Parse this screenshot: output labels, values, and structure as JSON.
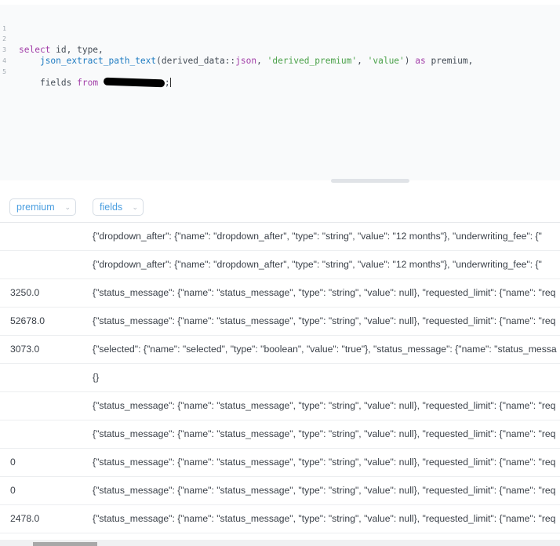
{
  "editor": {
    "lines": [
      {
        "num": "1"
      },
      {
        "num": "2",
        "p1": "select",
        "p2": " id, type,"
      },
      {
        "num": "3",
        "indent": "    ",
        "fn": "json_extract_path_text",
        "p1": "(derived_data::",
        "kw": "json",
        "p2": ", ",
        "s1": "'derived_premium'",
        "p3": ", ",
        "s2": "'value'",
        "p4": ") ",
        "kw2": "as",
        "p5": " premium,"
      },
      {
        "num": "4"
      },
      {
        "num": "5",
        "indent": "    ",
        "p1": "fields ",
        "kw": "from",
        "p2": " ",
        "p3": ";"
      }
    ]
  },
  "results": {
    "columns": [
      {
        "label": "premium"
      },
      {
        "label": "fields"
      }
    ],
    "rows": [
      {
        "premium": "",
        "fields": "{\"dropdown_after\": {\"name\": \"dropdown_after\", \"type\": \"string\", \"value\": \"12 months\"}, \"underwriting_fee\": {\""
      },
      {
        "premium": "",
        "fields": "{\"dropdown_after\": {\"name\": \"dropdown_after\", \"type\": \"string\", \"value\": \"12 months\"}, \"underwriting_fee\": {\""
      },
      {
        "premium": "3250.0",
        "fields": "{\"status_message\": {\"name\": \"status_message\", \"type\": \"string\", \"value\": null}, \"requested_limit\": {\"name\": \"req"
      },
      {
        "premium": "52678.0",
        "fields": "{\"status_message\": {\"name\": \"status_message\", \"type\": \"string\", \"value\": null}, \"requested_limit\": {\"name\": \"req"
      },
      {
        "premium": "3073.0",
        "fields": "{\"selected\": {\"name\": \"selected\", \"type\": \"boolean\", \"value\": \"true\"}, \"status_message\": {\"name\": \"status_messa"
      },
      {
        "premium": "",
        "fields": "{}"
      },
      {
        "premium": "",
        "fields": "{\"status_message\": {\"name\": \"status_message\", \"type\": \"string\", \"value\": null}, \"requested_limit\": {\"name\": \"req"
      },
      {
        "premium": "",
        "fields": "{\"status_message\": {\"name\": \"status_message\", \"type\": \"string\", \"value\": null}, \"requested_limit\": {\"name\": \"req"
      },
      {
        "premium": "0",
        "fields": "{\"status_message\": {\"name\": \"status_message\", \"type\": \"string\", \"value\": null}, \"requested_limit\": {\"name\": \"req"
      },
      {
        "premium": "0",
        "fields": "{\"status_message\": {\"name\": \"status_message\", \"type\": \"string\", \"value\": null}, \"requested_limit\": {\"name\": \"req"
      },
      {
        "premium": "2478.0",
        "fields": "{\"status_message\": {\"name\": \"status_message\", \"type\": \"string\", \"value\": null}, \"requested_limit\": {\"name\": \"req"
      }
    ]
  },
  "icons": {
    "column_sort": "chevron-down-icon"
  }
}
